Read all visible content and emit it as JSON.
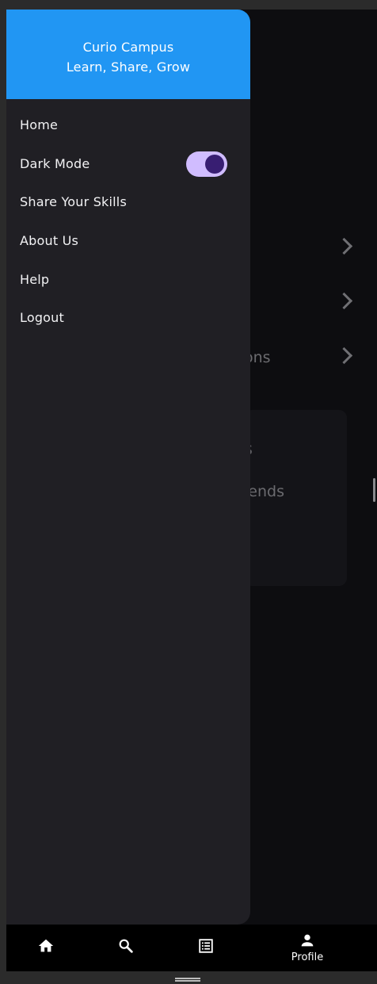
{
  "drawer": {
    "title": "Curio Campus",
    "subtitle": "Learn, Share, Grow",
    "items": [
      {
        "label": "Home"
      },
      {
        "label": "Dark Mode",
        "toggle_on": true
      },
      {
        "label": "Share Your Skills"
      },
      {
        "label": "About Us"
      },
      {
        "label": "Help"
      },
      {
        "label": "Logout"
      }
    ]
  },
  "background": {
    "rows": [
      {
        "text": ""
      },
      {
        "text": ""
      },
      {
        "text": "ons"
      }
    ],
    "card": {
      "line1": "s",
      "line2": "iends"
    }
  },
  "bottom_nav": {
    "items": [
      {
        "icon": "home-icon",
        "label": ""
      },
      {
        "icon": "search-icon",
        "label": ""
      },
      {
        "icon": "list-icon",
        "label": ""
      },
      {
        "icon": "person-icon",
        "label": "Profile",
        "active": true
      }
    ]
  },
  "colors": {
    "header_blue": "#2196f3",
    "drawer_bg": "#201f24",
    "toggle_track": "#d0bcff",
    "toggle_knob": "#381e72"
  }
}
